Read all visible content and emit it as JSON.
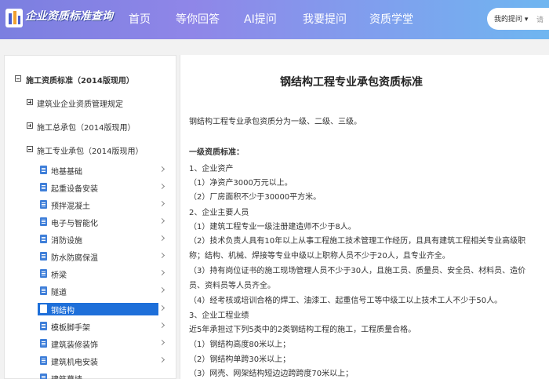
{
  "header": {
    "logo_text": "企业资质标准查询",
    "nav": [
      "首页",
      "等你回答",
      "AI提问",
      "我要提问",
      "资质学堂"
    ],
    "search_select": "我的提问",
    "search_placeholder": "请"
  },
  "sidebar": {
    "root": "施工资质标准（2014版现用）",
    "sections": [
      "建筑业企业资质管理规定",
      "施工总承包（2014版现用）",
      "施工专业承包（2014版现用）"
    ],
    "items": [
      "地基基础",
      "起重设备安装",
      "预拌混凝土",
      "电子与智能化",
      "消防设施",
      "防水防腐保温",
      "桥梁",
      "隧道",
      "钢结构",
      "模板脚手架",
      "建筑装修装饰",
      "建筑机电安装",
      "建筑幕墙"
    ],
    "active_item": "钢结构"
  },
  "content": {
    "title": "钢结构工程专业承包资质标准",
    "lines": [
      "钢结构工程专业承包资质分为一级、二级、三级。",
      "一级资质标准：",
      "1、企业资产",
      "（1）净资产3000万元以上。",
      "（2）厂房面积不少于30000平方米。",
      "2、企业主要人员",
      "（1）建筑工程专业一级注册建造师不少于8人。",
      "（2）技术负责人具有10年以上从事工程施工技术管理工作经历，且具有建筑工程相关专业高级职",
      "称；结构、机械、焊接等专业中级以上职称人员不少于20人，且专业齐全。",
      "（3）持有岗位证书的施工现场管理人员不少于30人，且施工员、质量员、安全员、材料员、造价",
      "员、资料员等人员齐全。",
      "（4）经考核或培训合格的焊工、油漆工、起重信号工等中级工以上技术工人不少于50人。",
      "3、企业工程业绩",
      "近5年承担过下列5类中的2类钢结构工程的施工，工程质量合格。",
      "（1）钢结构高度80米以上；",
      "（2）钢结构单跨30米以上；",
      "（3）网壳、网架结构短边边跨跨度70米以上；"
    ]
  },
  "colors": {
    "header_gradient_start": "#7b7fe0",
    "header_gradient_end": "#6fb6f0",
    "active_item_bg": "#1e6fd9",
    "doc_icon": "#3f7fd9"
  },
  "icons": {
    "logo": "logo-icon",
    "tree_collapse": "minus-box-icon",
    "tree_expand": "plus-box-icon",
    "leaf": "document-icon",
    "arrow": "chevron-right-icon",
    "dropdown": "caret-down-icon"
  }
}
